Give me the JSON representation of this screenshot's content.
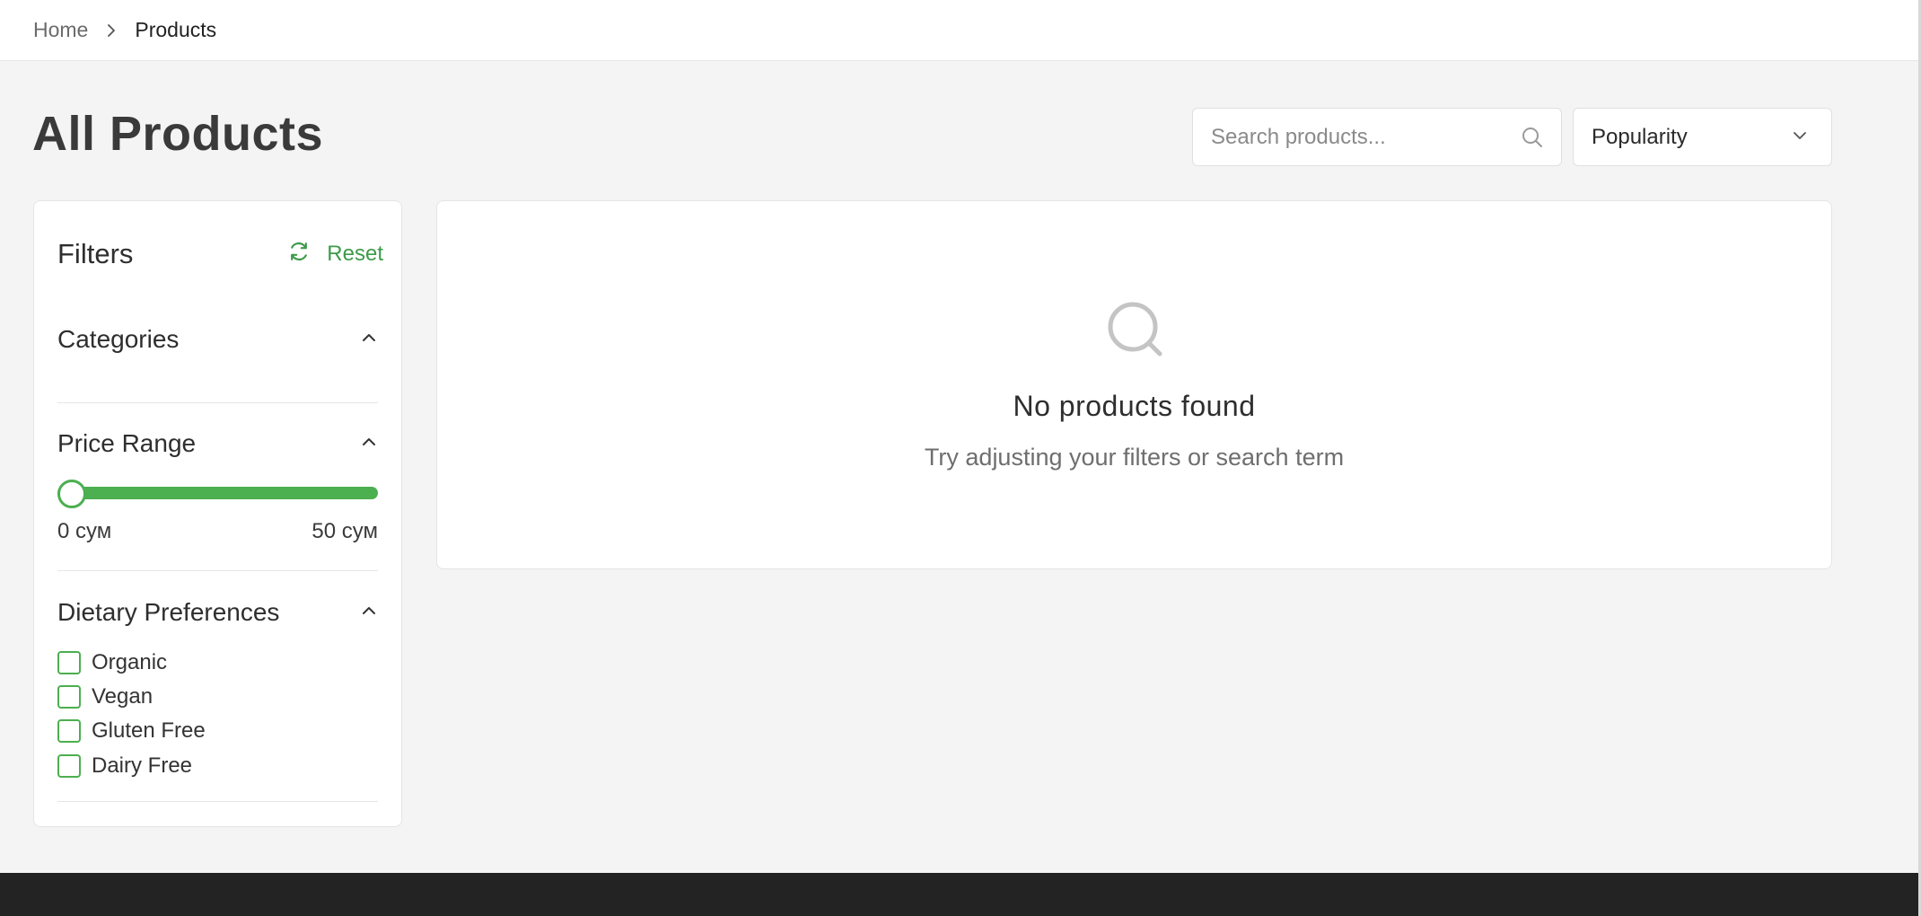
{
  "breadcrumb": {
    "home_label": "Home",
    "current_label": "Products"
  },
  "page": {
    "title": "All Products"
  },
  "search": {
    "placeholder": "Search products...",
    "value": ""
  },
  "sort": {
    "selected": "Popularity"
  },
  "filters": {
    "title": "Filters",
    "reset_label": "Reset",
    "sections": {
      "categories": {
        "title": "Categories"
      },
      "price_range": {
        "title": "Price Range",
        "min_label": "0 сум",
        "max_label": "50 сум",
        "selected_min_fraction": 0.0,
        "selected_max_fraction": 1.0
      },
      "dietary": {
        "title": "Dietary Preferences",
        "options": [
          {
            "label": "Organic",
            "checked": false
          },
          {
            "label": "Vegan",
            "checked": false
          },
          {
            "label": "Gluten Free",
            "checked": false
          },
          {
            "label": "Dairy Free",
            "checked": false
          }
        ]
      }
    }
  },
  "results": {
    "empty_title": "No products found",
    "empty_subtitle": "Try adjusting your filters or search term"
  },
  "colors": {
    "accent": "#4caf50",
    "accent_text": "#3e9a4a",
    "page_background": "#f4f4f4",
    "footer": "#232323"
  },
  "icons": {
    "breadcrumb_separator": "chevron-right-icon",
    "search": "search-icon",
    "sort_dropdown": "chevron-down-icon",
    "reset": "refresh-icon",
    "section_toggle": "chevron-up-icon",
    "empty_state": "search-icon"
  }
}
